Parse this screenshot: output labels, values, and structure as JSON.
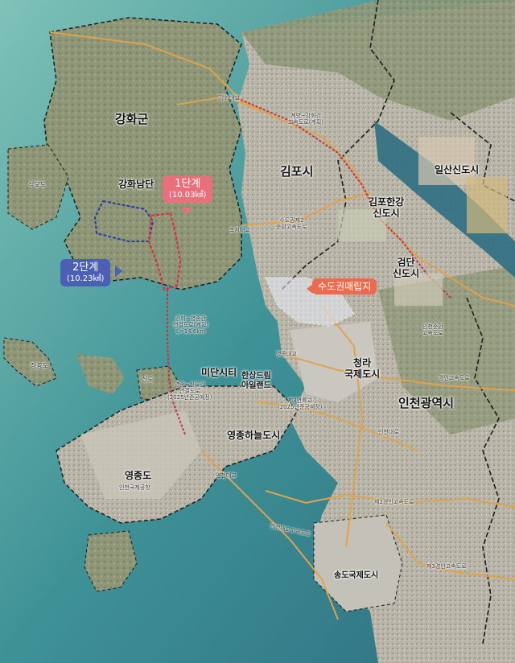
{
  "map": {
    "colors": {
      "sea": "#3a8e92",
      "shallow_sea": "#5fa9a2",
      "land": "#8f9b7b",
      "urban": "#b6b0a6",
      "admin_boundary": "#1b1b1b",
      "highway": "#e0a24a",
      "planned_route": "#c6333f",
      "stage1": "#d92f43",
      "stage2": "#2b3aa4",
      "reclaim": "#e9eefc"
    },
    "regions": {
      "ganghwa_gun": "강화군",
      "ganghwa_namdan": "강화남단",
      "gimpo_si": "김포시",
      "gimpo_hangang": "김포한강\n신도시",
      "geomdan": "검단\n신도시",
      "ilsan": "일산신도시",
      "cheongna": "청라\n국제도시",
      "incheon": "인천광역시",
      "midan": "미단시티",
      "hansang": "한상드림\n아일랜드",
      "yeongjong_sky": "영종하늘도시",
      "yeongjong_do": "영종도",
      "songdo": "송도국제도시",
      "seongmodo": "석모도",
      "jangbongdo": "장봉도",
      "sindo": "신도"
    },
    "callouts": {
      "stage1_title": "1단계",
      "stage1_sub": "(10.03㎢)",
      "stage2_title": "2단계",
      "stage2_sub": "(10.23㎢)",
      "metro_landfill": "수도권매립지"
    },
    "small_labels": {
      "ganghwa_bridge": "강화대교",
      "gyeyang_expressway": "계양~강화간\n고속도로(계획)",
      "suwon_bridge": "초지대교",
      "sudo_ring": "수도권제2\n순환고속도로",
      "ganghwa_yeongjong": "강화~영종간\n연결도로(계획)\nL=14.6km",
      "yeongjong_sindo": "영종~신도간\n연결도로\n(2025년준공예정)",
      "yeongjong_bridge": "영종대교",
      "third_bridge": "제3연륙교\n(2025년준공예정)",
      "incheon_airport": "인천국제공항",
      "incheon_bridge": "인천대교",
      "cheongna_expressway": "인천대로",
      "gyeongin_2nd": "제2경인고속도로",
      "gyeongin_3rd": "제3경인고속도로",
      "gyeongin_exp": "경인고속도로",
      "incheon_daegyo_exp": "인천대교고속도로",
      "incheon_ring": "인천순환\n고속도로"
    }
  }
}
